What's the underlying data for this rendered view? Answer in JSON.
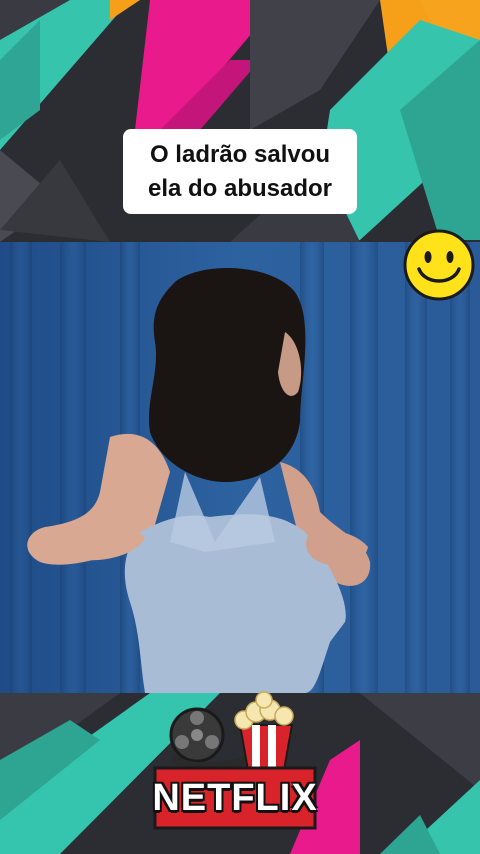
{
  "caption": {
    "line1": "O ladrão salvou",
    "line2": "ela do abusador"
  },
  "branding": {
    "label": "NETFLIX"
  },
  "icons": {
    "smiley": "smiley-face-icon",
    "popcorn": "popcorn-icon",
    "film_reel": "film-reel-icon"
  },
  "colors": {
    "background": "#2b2b31",
    "magenta": "#e8198b",
    "teal": "#35c4ae",
    "orange": "#f7a21b",
    "curtain": "#2a5b98",
    "caption_bg": "#ffffff",
    "smiley": "#ffe21a",
    "netflix_red": "#d9232a"
  }
}
